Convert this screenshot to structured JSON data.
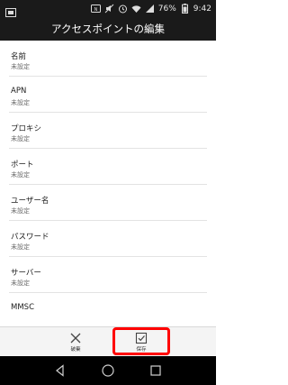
{
  "status_bar": {
    "battery": "76%",
    "time": "9:42",
    "icons": [
      "nfc-icon",
      "mute-icon",
      "alarm-icon",
      "wifi-icon",
      "signal-icon",
      "battery-icon"
    ]
  },
  "title_bar": {
    "title": "アクセスポイントの編集"
  },
  "list": {
    "items": [
      {
        "name": "名前",
        "value": "未設定"
      },
      {
        "name": "APN",
        "value": "未設定"
      },
      {
        "name": "プロキシ",
        "value": "未設定"
      },
      {
        "name": "ポート",
        "value": "未設定"
      },
      {
        "name": "ユーザー名",
        "value": "未設定"
      },
      {
        "name": "パスワード",
        "value": "未設定"
      },
      {
        "name": "サーバー",
        "value": "未設定"
      },
      {
        "name": "MMSC",
        "value": ""
      }
    ]
  },
  "action_bar": {
    "discard_label": "破棄",
    "save_label": "保存",
    "highlight_color": "#ff0000"
  },
  "nav_bar": {
    "icons": [
      "back-icon",
      "home-icon",
      "recent-apps-icon"
    ]
  }
}
